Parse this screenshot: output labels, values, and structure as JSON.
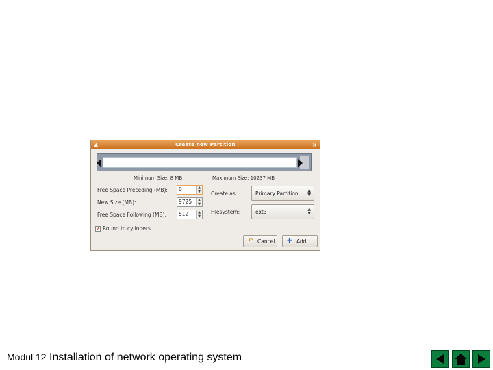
{
  "dialog": {
    "title": "Create new Partition",
    "close_glyph": "×",
    "min_size": "Minimum Size: 8 MB",
    "max_size": "Maximum Size: 10237 MB",
    "fields": [
      {
        "label": "Free Space Preceding (MB):",
        "value": "0"
      },
      {
        "label": "New Size (MB):",
        "value": "9725"
      },
      {
        "label": "Free Space Following (MB):",
        "value": "512"
      }
    ],
    "create_as": {
      "label": "Create as:",
      "value": "Primary Partition"
    },
    "filesystem": {
      "label": "Filesystem:",
      "value": "ext3"
    },
    "round_cylinders": {
      "label": "Round to cylinders",
      "checked": true
    },
    "cancel_label": "Cancel",
    "add_label": "Add"
  },
  "footer": {
    "module": "Modul 12",
    "title": "Installation of network operating system"
  },
  "nav": {
    "prev_icon": "arrow-left-icon",
    "home_icon": "home-icon",
    "next_icon": "arrow-right-icon",
    "color": "#0b7d3c"
  }
}
